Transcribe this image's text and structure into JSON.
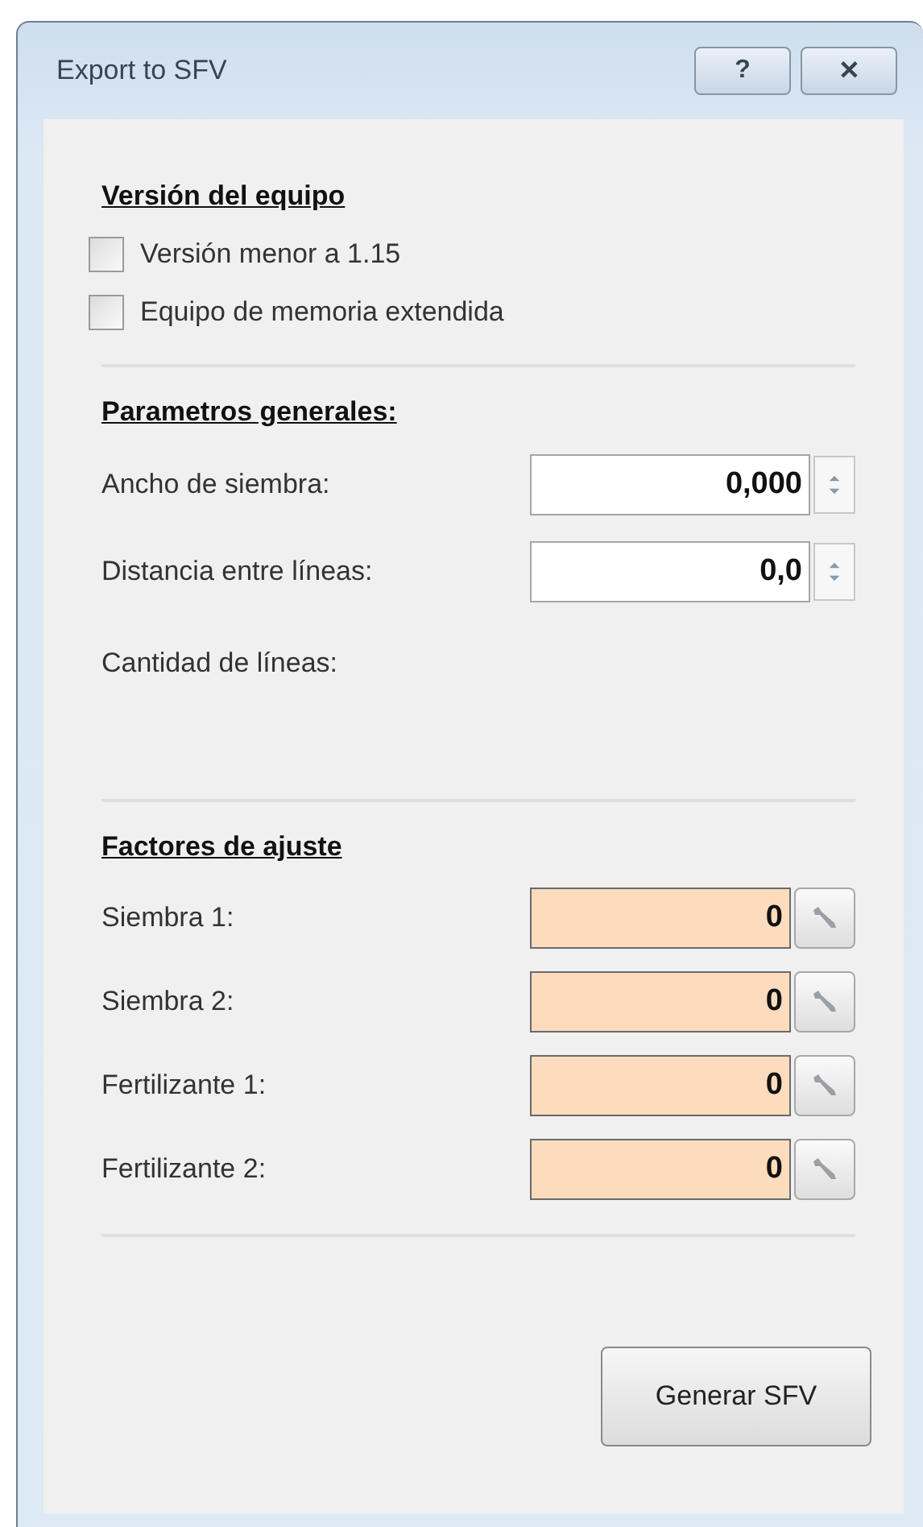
{
  "window": {
    "title": "Export to SFV",
    "title_buttons": [
      "?",
      "✕"
    ]
  },
  "sections": [
    {
      "kind": "checks",
      "heading": "Versión del equipo",
      "items": [
        {
          "label": "Versión menor a 1.15",
          "checked": false
        },
        {
          "label": "Equipo de memoria extendida",
          "checked": false
        }
      ]
    },
    {
      "kind": "params",
      "heading": "Parametros generales:",
      "items": [
        {
          "kind": "spin",
          "label": "Ancho de siembra:",
          "value": "0,000"
        },
        {
          "kind": "spin",
          "label": "Distancia entre líneas:",
          "value": "0,0"
        },
        {
          "kind": "text",
          "label": "Cantidad de líneas:"
        }
      ]
    },
    {
      "kind": "factors",
      "heading": "Factores de ajuste",
      "items": [
        {
          "label": "Siembra 1:",
          "value": "0"
        },
        {
          "label": "Siembra 2:",
          "value": "0"
        },
        {
          "label": "Fertilizante 1:",
          "value": "0"
        },
        {
          "label": "Fertilizante 2:",
          "value": "0"
        }
      ]
    }
  ],
  "button": "Generar SFV"
}
